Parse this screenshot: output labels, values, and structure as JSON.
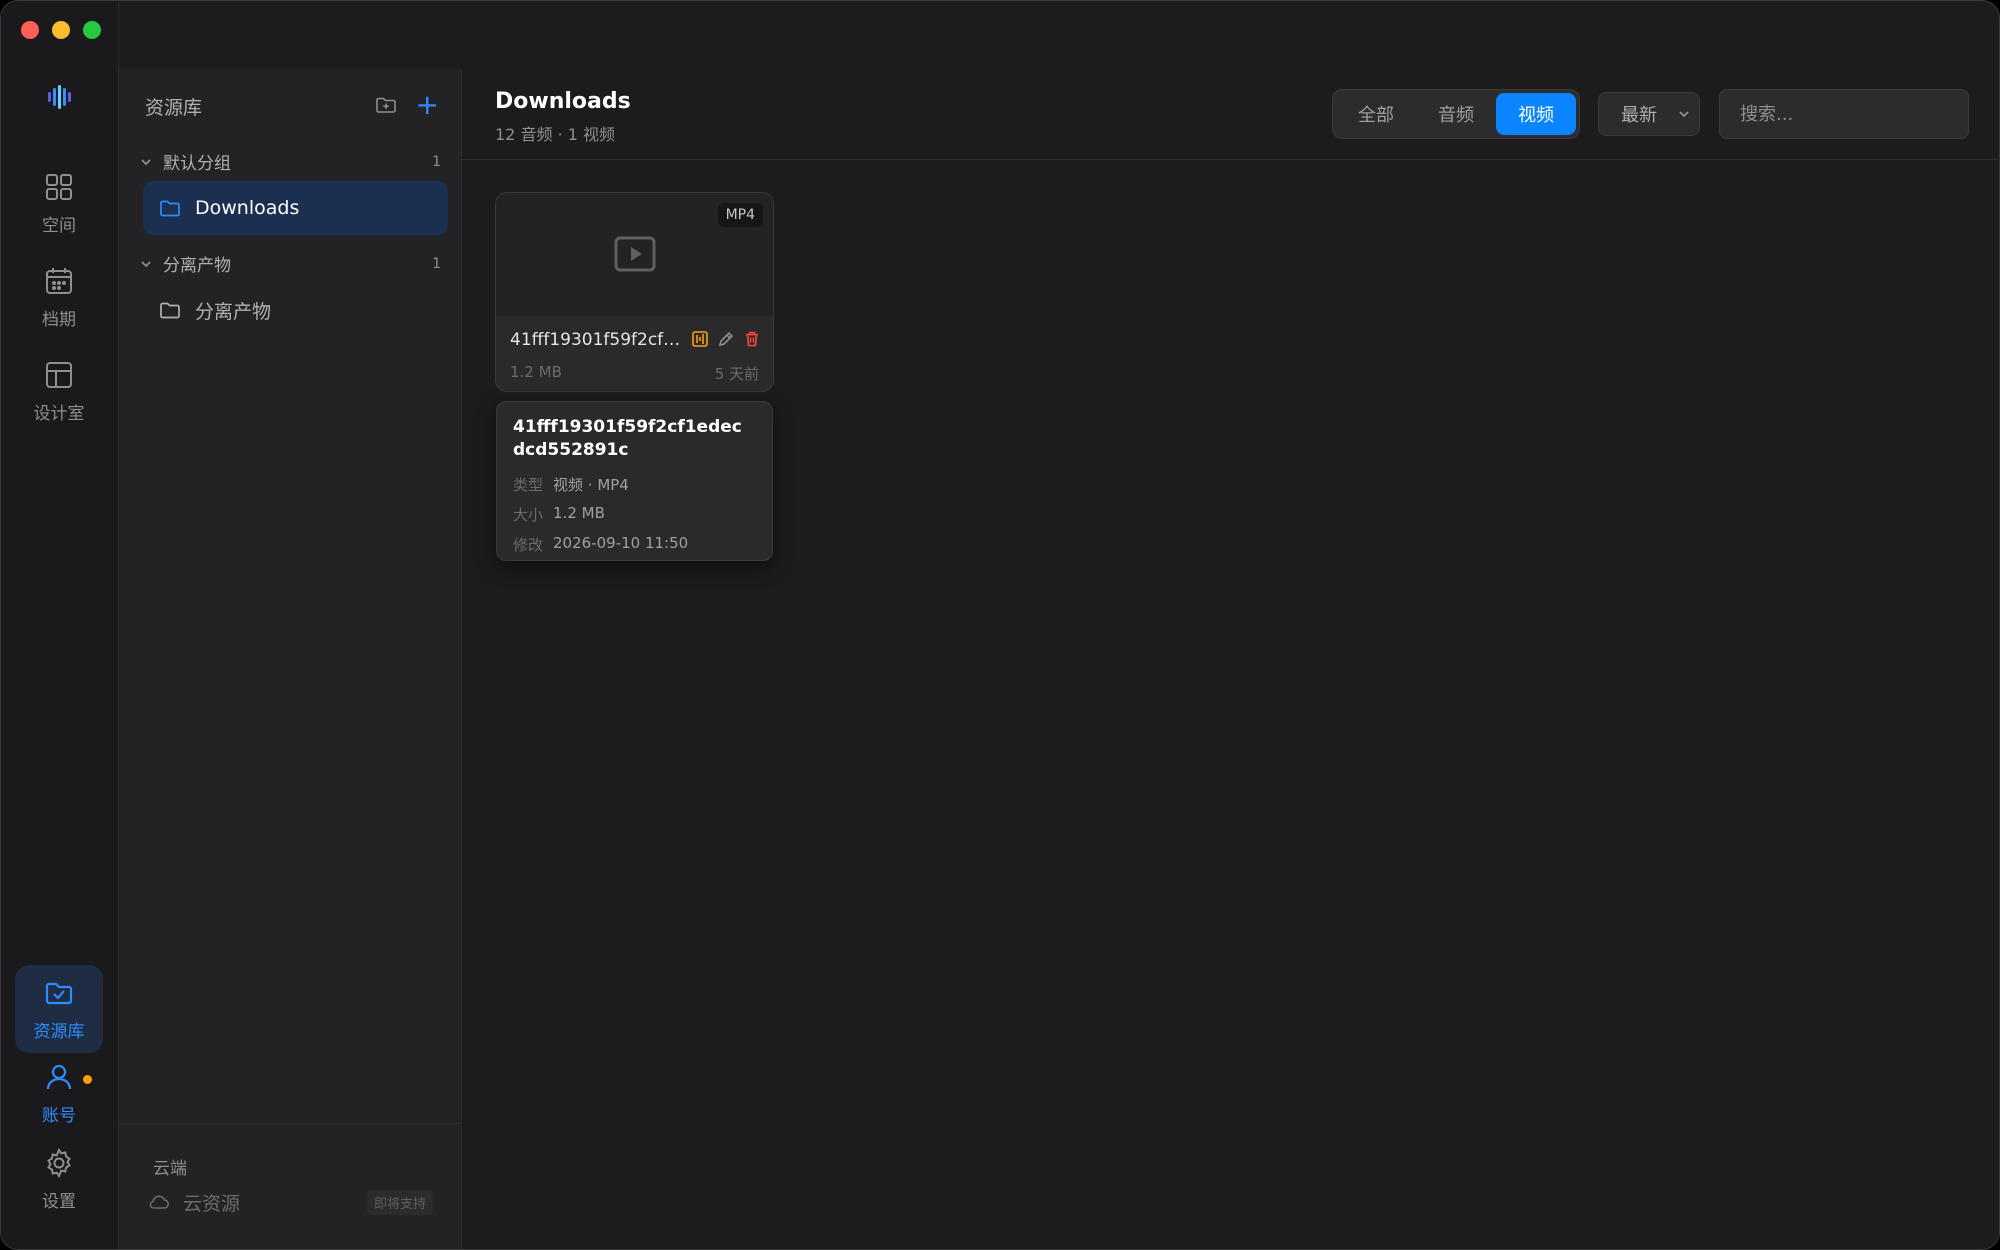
{
  "rail": {
    "items": [
      {
        "label": "空间",
        "icon": "grid-icon"
      },
      {
        "label": "档期",
        "icon": "calendar-icon"
      },
      {
        "label": "设计室",
        "icon": "layout-icon"
      },
      {
        "label": "资源库",
        "icon": "folder-check-icon"
      },
      {
        "label": "账号",
        "icon": "user-icon"
      },
      {
        "label": "设置",
        "icon": "gear-icon"
      }
    ]
  },
  "library": {
    "title": "资源库",
    "groups": [
      {
        "name": "默认分组",
        "count": "1",
        "folders": [
          {
            "name": "Downloads"
          }
        ]
      },
      {
        "name": "分离产物",
        "count": "1",
        "folders": [
          {
            "name": "分离产物"
          }
        ]
      }
    ],
    "cloud": {
      "title": "云端",
      "item": "云资源",
      "badge": "即将支持"
    }
  },
  "main": {
    "title": "Downloads",
    "subtitle": "12 音频 · 1 视频",
    "tabs": [
      {
        "label": "全部"
      },
      {
        "label": "音频"
      },
      {
        "label": "视频"
      }
    ],
    "sort": {
      "label": "最新"
    },
    "search": {
      "placeholder": "搜索..."
    },
    "card": {
      "format": "MP4",
      "name": "41fff19301f59f2cf1edecdcd552891c",
      "size": "1.2 MB",
      "time": "5 天前"
    },
    "tooltip": {
      "name": "41fff19301f59f2cf1edecdcd552891c",
      "rows": [
        {
          "key": "类型",
          "value": "视频 · MP4"
        },
        {
          "key": "大小",
          "value": "1.2 MB"
        },
        {
          "key": "修改",
          "value": "2026-09-10 11:50"
        }
      ]
    }
  },
  "colors": {
    "accent": "#0a84ff",
    "active_rail": "#1f2d44",
    "warning": "#ff9f0a",
    "danger": "#ff453a"
  }
}
